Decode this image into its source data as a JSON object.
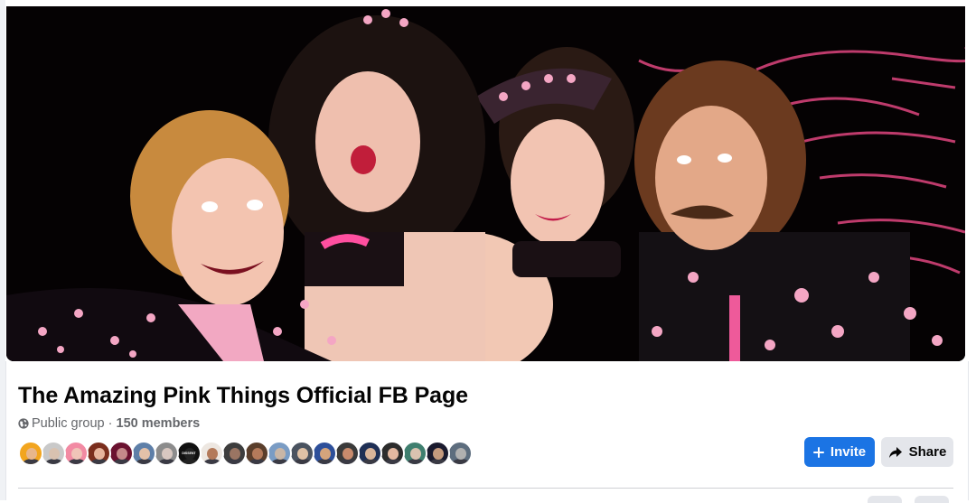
{
  "group": {
    "title": "The Amazing Pink Things Official FB Page",
    "privacy": "Public group",
    "separator": " · ",
    "members": "150 members"
  },
  "cover": {
    "icon": "group-cover-photo",
    "background": "#050203",
    "accent": "#ee5a9a"
  },
  "actions": {
    "invite_label": "Invite",
    "invite_icon": "plus-icon",
    "share_label": "Share",
    "share_icon": "share-arrow-icon"
  },
  "member_avatars": [
    {
      "skin": "#e8b68b",
      "bg": "#f2a51f"
    },
    {
      "skin": "#d9c2b0",
      "bg": "#c9c9c9"
    },
    {
      "skin": "#f0c4b8",
      "bg": "#f28aa3"
    },
    {
      "skin": "#e7b49c",
      "bg": "#7b2e1d"
    },
    {
      "skin": "#c68a8a",
      "bg": "#6b1230"
    },
    {
      "skin": "#e3c1a9",
      "bg": "#5e7fa8"
    },
    {
      "skin": "#d8c7c0",
      "bg": "#8c8c8c"
    },
    {
      "skin": "#222222",
      "bg": "#111111",
      "label": "DISSENT"
    },
    {
      "skin": "#b47a5a",
      "bg": "#ede7e1"
    },
    {
      "skin": "#9a7563",
      "bg": "#3d3d3d"
    },
    {
      "skin": "#b47a5a",
      "bg": "#5a3e2b"
    },
    {
      "skin": "#c9b6a6",
      "bg": "#7a9cc4"
    },
    {
      "skin": "#e0c2a6",
      "bg": "#4a5360"
    },
    {
      "skin": "#d4a47c",
      "bg": "#2d4f9a"
    },
    {
      "skin": "#c98b6c",
      "bg": "#3a3a3a"
    },
    {
      "skin": "#d8b49a",
      "bg": "#1e2f55"
    },
    {
      "skin": "#e3b8a0",
      "bg": "#2c2c2c"
    },
    {
      "skin": "#d9c3b0",
      "bg": "#3f7f6f"
    },
    {
      "skin": "#c49a7e",
      "bg": "#1a1a2e"
    },
    {
      "skin": "#b0b0b0",
      "bg": "#5d6d7e"
    }
  ]
}
